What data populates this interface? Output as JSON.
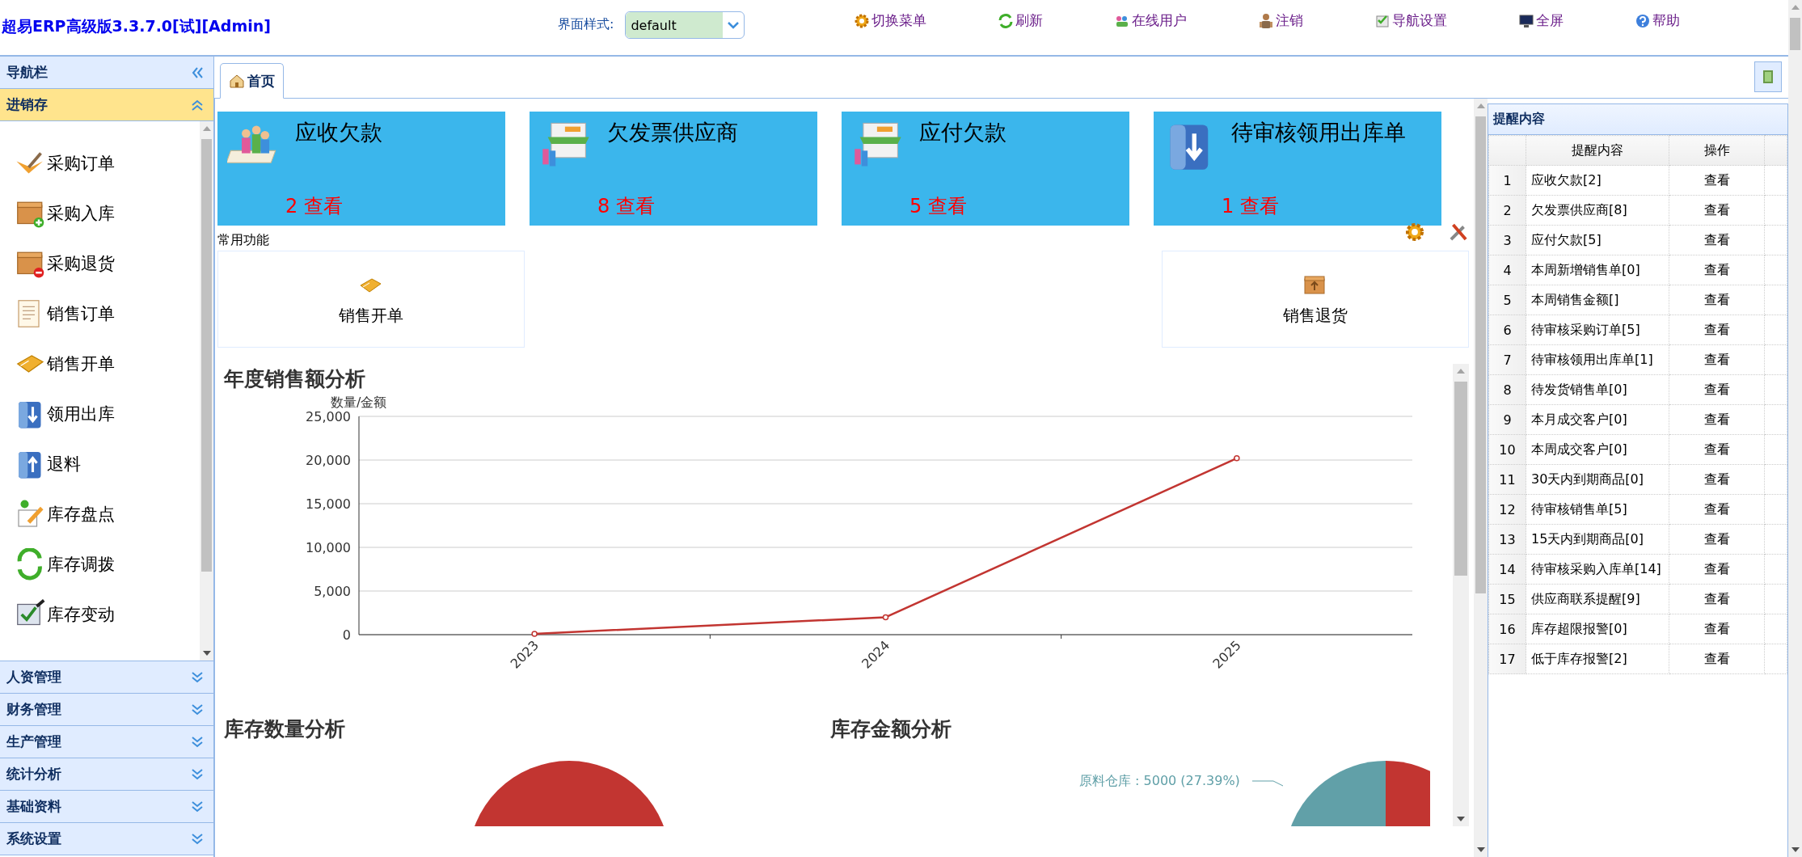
{
  "app": {
    "title": "超易ERP高级版3.3.7.0[试][Admin]"
  },
  "style_picker": {
    "label": "界面样式:",
    "value": "default"
  },
  "toolbar": [
    {
      "label": "切换菜单"
    },
    {
      "label": "刷新"
    },
    {
      "label": "在线用户"
    },
    {
      "label": "注销"
    },
    {
      "label": "导航设置"
    },
    {
      "label": "全屏"
    },
    {
      "label": "帮助"
    }
  ],
  "sidebar": {
    "title": "导航栏",
    "sections": [
      {
        "label": "进销存",
        "expanded": true,
        "items": [
          "采购订单",
          "采购入库",
          "采购退货",
          "销售订单",
          "销售开单",
          "领用出库",
          "退料",
          "库存盘点",
          "库存调拨",
          "库存变动"
        ]
      },
      {
        "label": "人资管理",
        "expanded": false
      },
      {
        "label": "财务管理",
        "expanded": false
      },
      {
        "label": "生产管理",
        "expanded": false
      },
      {
        "label": "统计分析",
        "expanded": false
      },
      {
        "label": "基础资料",
        "expanded": false
      },
      {
        "label": "系统设置",
        "expanded": false
      }
    ]
  },
  "tabs": [
    {
      "label": "首页",
      "selected": true
    }
  ],
  "summary_cards": [
    {
      "title": "应收欠款",
      "link": "2 查看"
    },
    {
      "title": "欠发票供应商",
      "link": "8 查看"
    },
    {
      "title": "应付欠款",
      "link": "5 查看"
    },
    {
      "title": "待审核领用出库单",
      "link": "1 查看"
    }
  ],
  "shortcuts": {
    "title": "常用功能",
    "items": [
      {
        "label": "销售开单"
      },
      {
        "label": "销售退货"
      }
    ]
  },
  "sales_chart": {
    "title": "年度销售额分析",
    "chart_data": {
      "type": "line",
      "grid": true,
      "marker": true,
      "ylabel": "数量/金额",
      "categories": [
        "2023",
        "2024",
        "2025"
      ],
      "series": [
        {
          "color": "#c23531",
          "values": [
            100,
            2000,
            20200
          ]
        }
      ],
      "ylim": [
        0,
        25000
      ],
      "yticks": [
        {
          "value": 0,
          "label": "0"
        },
        {
          "value": 5000,
          "label": "5,000"
        },
        {
          "value": 10000,
          "label": "10,000"
        },
        {
          "value": 15000,
          "label": "15,000"
        },
        {
          "value": 20000,
          "label": "20,000"
        },
        {
          "value": 25000,
          "label": "25,000"
        }
      ]
    }
  },
  "inventory_charts": [
    {
      "title": "库存数量分析"
    },
    {
      "title": "库存金额分析",
      "slice_labels": [
        "原料仓库 : 5000 (27.39%)"
      ]
    }
  ],
  "reminders": {
    "title": "提醒内容",
    "columns": [
      "提醒内容",
      "操作"
    ],
    "rows": [
      {
        "index": "1",
        "content": "应收欠款[2]",
        "action": "查看"
      },
      {
        "index": "2",
        "content": "欠发票供应商[8]",
        "action": "查看"
      },
      {
        "index": "3",
        "content": "应付欠款[5]",
        "action": "查看"
      },
      {
        "index": "4",
        "content": "本周新增销售单[0]",
        "action": "查看"
      },
      {
        "index": "5",
        "content": "本周销售金额[]",
        "action": "查看"
      },
      {
        "index": "6",
        "content": "待审核采购订单[5]",
        "action": "查看"
      },
      {
        "index": "7",
        "content": "待审核领用出库单[1]",
        "action": "查看"
      },
      {
        "index": "8",
        "content": "待发货销售单[0]",
        "action": "查看"
      },
      {
        "index": "9",
        "content": "本月成交客户[0]",
        "action": "查看"
      },
      {
        "index": "10",
        "content": "本周成交客户[0]",
        "action": "查看"
      },
      {
        "index": "11",
        "content": "30天内到期商品[0]",
        "action": "查看"
      },
      {
        "index": "12",
        "content": "待审核销售单[5]",
        "action": "查看"
      },
      {
        "index": "13",
        "content": "15天内到期商品[0]",
        "action": "查看"
      },
      {
        "index": "14",
        "content": "待审核采购入库单[14]",
        "action": "查看"
      },
      {
        "index": "15",
        "content": "供应商联系提醒[9]",
        "action": "查看"
      },
      {
        "index": "16",
        "content": "库存超限报警[0]",
        "action": "查看"
      },
      {
        "index": "17",
        "content": "低于库存报警[2]",
        "action": "查看"
      }
    ]
  }
}
